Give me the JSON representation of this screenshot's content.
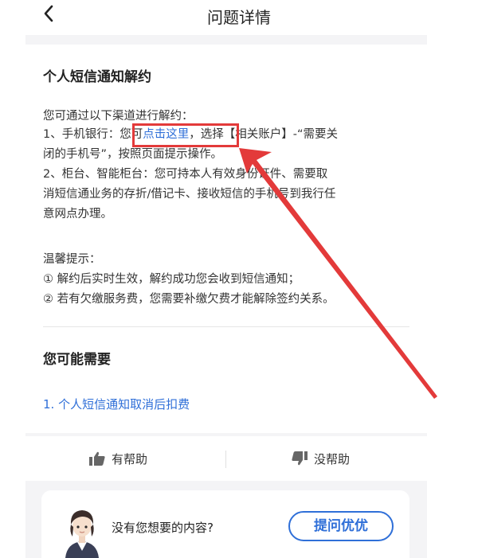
{
  "header": {
    "title": "问题详情",
    "back_icon": "chevron-left-icon"
  },
  "article": {
    "title": "个人短信通知解约",
    "intro": "您可通过以下渠道进行解约：",
    "mobile_prefix": "1、手机银行：您可",
    "mobile_link": "点击这里",
    "mobile_suffix": "，选择【相关账户】-“需要关",
    "mobile_line2": "闭的手机号”，按照页面提示操作。",
    "counter_line1": "2、柜台、智能柜台：您可持本人有效身份证件、需要取",
    "counter_line2": "消短信通业务的存折/借记卡、接收短信的手机号到我行任",
    "counter_line3": "意网点办理。",
    "tips_title": "温馨提示：",
    "tip1": "① 解约后实时生效，解约成功您会收到短信通知；",
    "tip2": "② 若有欠缴服务费，您需要补缴欠费才能解除签约关系。"
  },
  "related": {
    "title": "您可能需要",
    "items": [
      "1. 个人短信通知取消后扣费"
    ]
  },
  "feedback": {
    "helpful_label": "有帮助",
    "unhelpful_label": "没帮助",
    "helpful_icon": "thumbs-up-icon",
    "unhelpful_icon": "thumbs-down-icon"
  },
  "ask": {
    "prompt": "没有您想要的内容?",
    "button_label": "提问优优",
    "avatar": "assistant-avatar"
  },
  "annotations": {
    "highlight_color": "#e33a3a",
    "arrow_color": "#e33a3a"
  },
  "colors": {
    "accent": "#2f6fd8",
    "background": "#f4f4f6"
  }
}
